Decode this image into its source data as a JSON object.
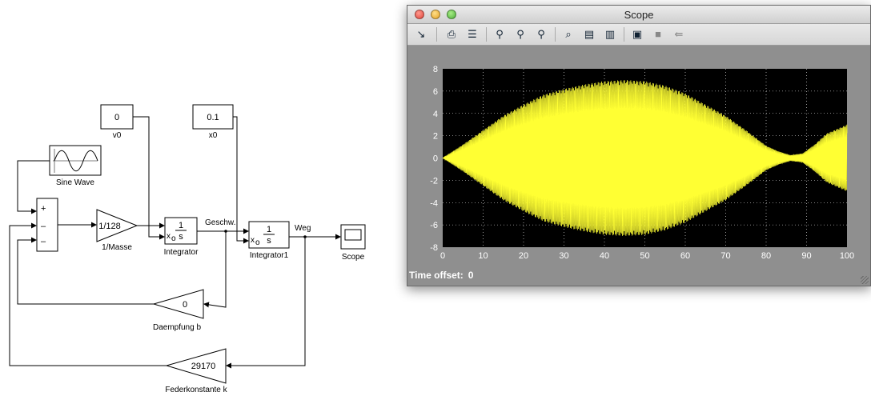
{
  "diagram": {
    "v0": {
      "value": "0",
      "label": "v0"
    },
    "x0": {
      "value": "0.1",
      "label": "x0"
    },
    "sine": {
      "label": "Sine Wave"
    },
    "sum": {
      "signs": [
        "+",
        "–",
        "–"
      ]
    },
    "gain_mass": {
      "value": "1/128",
      "label": "1/Masse"
    },
    "integrator1": {
      "num": "1",
      "den": "s",
      "xo": "x",
      "xo_sub": "o",
      "label": "Integrator"
    },
    "integrator2": {
      "num": "1",
      "den": "s",
      "xo": "x",
      "xo_sub": "o",
      "label": "Integrator1"
    },
    "signal_velocity": "Geschw.",
    "signal_position": "Weg",
    "scope": {
      "label": "Scope"
    },
    "gain_damping": {
      "value": "0",
      "label": "Daempfung b"
    },
    "gain_spring": {
      "value": "29170",
      "label": "Federkonstante k"
    }
  },
  "window": {
    "title": "Scope",
    "time_offset_label": "Time offset:",
    "time_offset_value": "0",
    "toolbar_icons": [
      "pointer-icon",
      "print-icon",
      "parameters-icon",
      "zoom-icon",
      "zoom-x-icon",
      "zoom-y-icon",
      "autoscale-icon",
      "save-axes-icon",
      "restore-axes-icon",
      "floating-icon",
      "lock-icon",
      "signal-select-icon"
    ]
  },
  "chart_data": {
    "type": "line",
    "x_ticks": [
      "0",
      "10",
      "20",
      "30",
      "40",
      "50",
      "60",
      "70",
      "80",
      "90",
      "100"
    ],
    "y_ticks": [
      "-8",
      "-6",
      "-4",
      "-2",
      "0",
      "2",
      "4",
      "6",
      "8"
    ],
    "xlim": [
      0,
      100
    ],
    "ylim": [
      -8,
      8
    ],
    "grid": true,
    "background": "#000000",
    "line_color": "#ffff33",
    "envelope": {
      "t": [
        0,
        5,
        10,
        15,
        20,
        25,
        30,
        35,
        40,
        45,
        50,
        55,
        60,
        65,
        70,
        75,
        80,
        83,
        86,
        89,
        92,
        95,
        100
      ],
      "amplitude": [
        0,
        1.2,
        2.5,
        3.8,
        4.8,
        5.7,
        6.2,
        6.6,
        6.9,
        7.0,
        6.9,
        6.5,
        5.8,
        4.8,
        3.8,
        2.5,
        1.1,
        0.6,
        0.25,
        0.4,
        1.2,
        2.2,
        3.0
      ]
    }
  }
}
